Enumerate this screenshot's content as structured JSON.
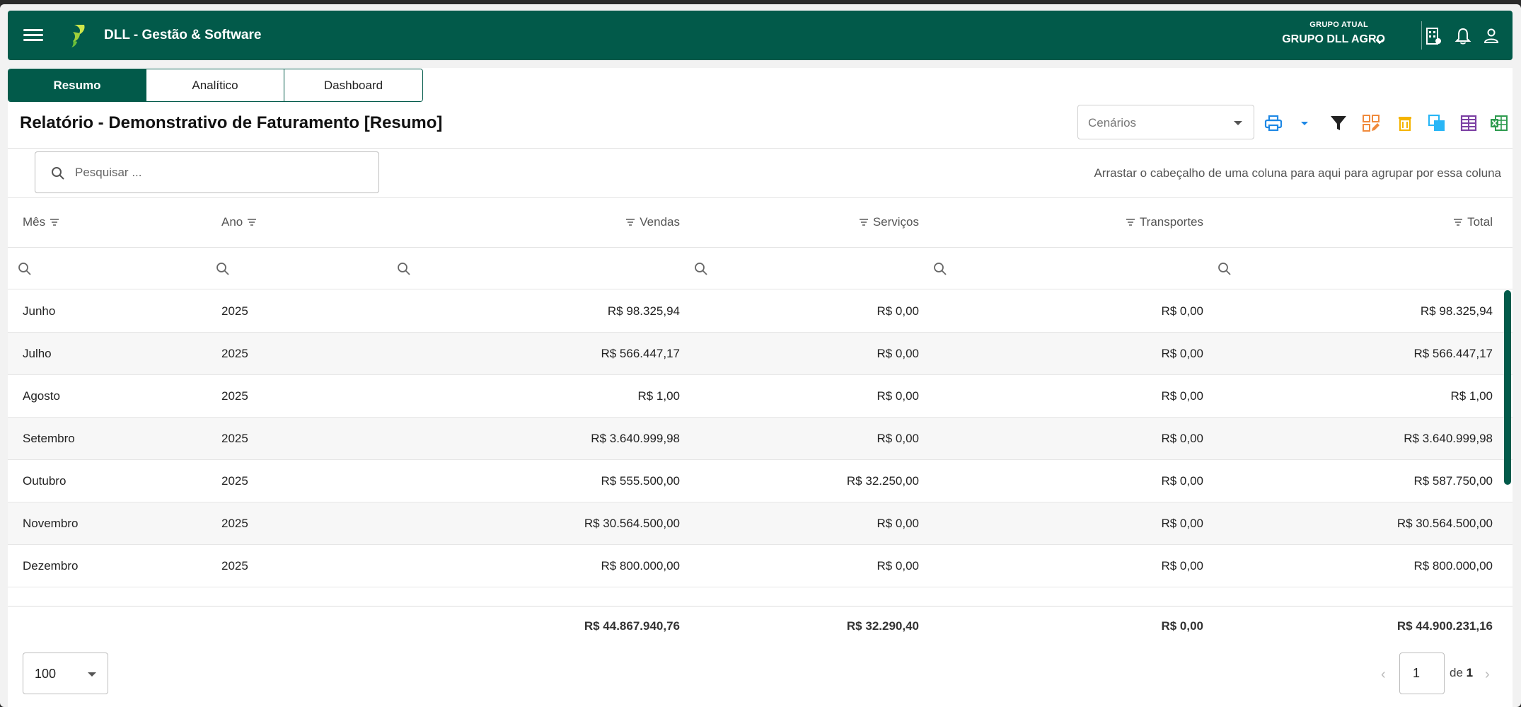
{
  "app": {
    "title": "DLL - Gestão & Software"
  },
  "group": {
    "label": "GRUPO ATUAL",
    "value": "GRUPO DLL AGRO"
  },
  "tabs": [
    {
      "label": "Resumo",
      "active": true
    },
    {
      "label": "Analítico",
      "active": false
    },
    {
      "label": "Dashboard",
      "active": false
    }
  ],
  "report": {
    "title": "Relatório - Demonstrativo de Faturamento [Resumo]"
  },
  "scenario": {
    "placeholder": "Cenários"
  },
  "search": {
    "placeholder": "Pesquisar ..."
  },
  "group_hint": "Arrastar o cabeçalho de uma coluna para aqui para agrupar por essa coluna",
  "columns": [
    "Mês",
    "Ano",
    "Vendas",
    "Serviços",
    "Transportes",
    "Total"
  ],
  "rows": [
    [
      "Junho",
      "2025",
      "R$ 98.325,94",
      "R$ 0,00",
      "R$ 0,00",
      "R$ 98.325,94"
    ],
    [
      "Julho",
      "2025",
      "R$ 566.447,17",
      "R$ 0,00",
      "R$ 0,00",
      "R$ 566.447,17"
    ],
    [
      "Agosto",
      "2025",
      "R$ 1,00",
      "R$ 0,00",
      "R$ 0,00",
      "R$ 1,00"
    ],
    [
      "Setembro",
      "2025",
      "R$ 3.640.999,98",
      "R$ 0,00",
      "R$ 0,00",
      "R$ 3.640.999,98"
    ],
    [
      "Outubro",
      "2025",
      "R$ 555.500,00",
      "R$ 32.250,00",
      "R$ 0,00",
      "R$ 587.750,00"
    ],
    [
      "Novembro",
      "2025",
      "R$ 30.564.500,00",
      "R$ 0,00",
      "R$ 0,00",
      "R$ 30.564.500,00"
    ],
    [
      "Dezembro",
      "2025",
      "R$ 800.000,00",
      "R$ 0,00",
      "R$ 0,00",
      "R$ 800.000,00"
    ]
  ],
  "totals": {
    "vendas": "R$ 44.867.940,76",
    "servicos": "R$ 32.290,40",
    "transportes": "R$ 0,00",
    "total": "R$ 44.900.231,16"
  },
  "pager": {
    "page_size": "100",
    "page": "1",
    "of_label": "de",
    "total_pages": "1"
  },
  "colors": {
    "brand": "#025a4a",
    "print": "#1e88e5",
    "orange": "#f08a3c",
    "yellow": "#f5b400",
    "cyan": "#29b6f6",
    "purple": "#7b3fa3",
    "excel": "#2e9b4f"
  }
}
